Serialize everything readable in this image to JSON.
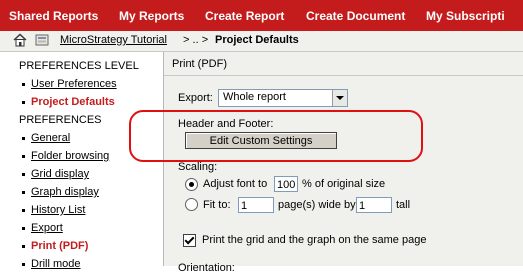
{
  "topnav": {
    "tabs": [
      "Shared Reports",
      "My Reports",
      "Create Report",
      "Create Document",
      "My Subscripti"
    ]
  },
  "breadcrumb": {
    "project_link": "MicroStrategy Tutorial",
    "separator": " > .. > ",
    "current": "Project Defaults"
  },
  "sidebar": {
    "level_header": "PREFERENCES LEVEL",
    "level_items": [
      {
        "label": "User Preferences",
        "active": false
      },
      {
        "label": "Project Defaults",
        "active": true
      }
    ],
    "prefs_header": "PREFERENCES",
    "pref_items": [
      {
        "label": "General",
        "active": false
      },
      {
        "label": "Folder browsing",
        "active": false
      },
      {
        "label": "Grid display",
        "active": false
      },
      {
        "label": "Graph display",
        "active": false
      },
      {
        "label": "History List",
        "active": false
      },
      {
        "label": "Export",
        "active": false
      },
      {
        "label": "Print (PDF)",
        "active": true
      },
      {
        "label": "Drill mode",
        "active": false
      }
    ]
  },
  "main": {
    "title": "Print (PDF)",
    "export_label": "Export:",
    "export_value": "Whole report",
    "header_footer_label": "Header and Footer:",
    "edit_button": "Edit Custom Settings",
    "scaling_label": "Scaling:",
    "adjust_label": "Adjust font to",
    "adjust_value": "100",
    "adjust_suffix": "% of original size",
    "fit_label": "Fit to:",
    "fit_wide_value": "1",
    "fit_wide_suffix": "page(s) wide by",
    "fit_tall_value": "1",
    "fit_tall_suffix": "tall",
    "same_page_label": "Print the grid and the graph on the same page",
    "orientation_label": "Orientation:"
  },
  "colors": {
    "brand_red": "#c41c1c",
    "highlight_red": "#e01010"
  }
}
